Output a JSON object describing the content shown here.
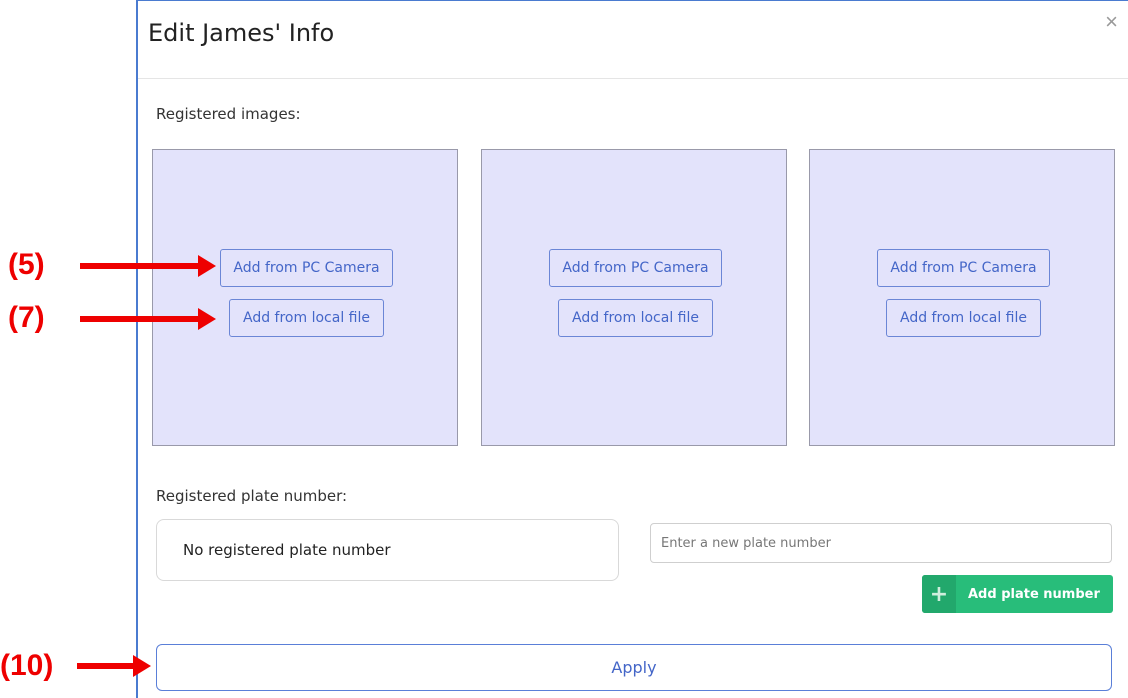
{
  "dialog": {
    "title": "Edit James' Info",
    "close_symbol": "×"
  },
  "images_section": {
    "label": "Registered images:",
    "slots": [
      {
        "camera_label": "Add from PC Camera",
        "file_label": "Add from local file"
      },
      {
        "camera_label": "Add from PC Camera",
        "file_label": "Add from local file"
      },
      {
        "camera_label": "Add from PC Camera",
        "file_label": "Add from local file"
      }
    ]
  },
  "plate_section": {
    "label": "Registered plate number:",
    "current_value": "No registered plate number",
    "input_placeholder": "Enter a new plate number",
    "add_label": "Add plate number",
    "add_icon": "plus-icon"
  },
  "apply_label": "Apply",
  "annotations": {
    "a5": "(5)",
    "a7": "(7)",
    "a10": "(10)"
  },
  "colors": {
    "accent": "#4466c8",
    "image_slot_bg": "#e3e3fb",
    "add_plate_bg": "#28bd7a",
    "annotation": "#ee0000"
  }
}
